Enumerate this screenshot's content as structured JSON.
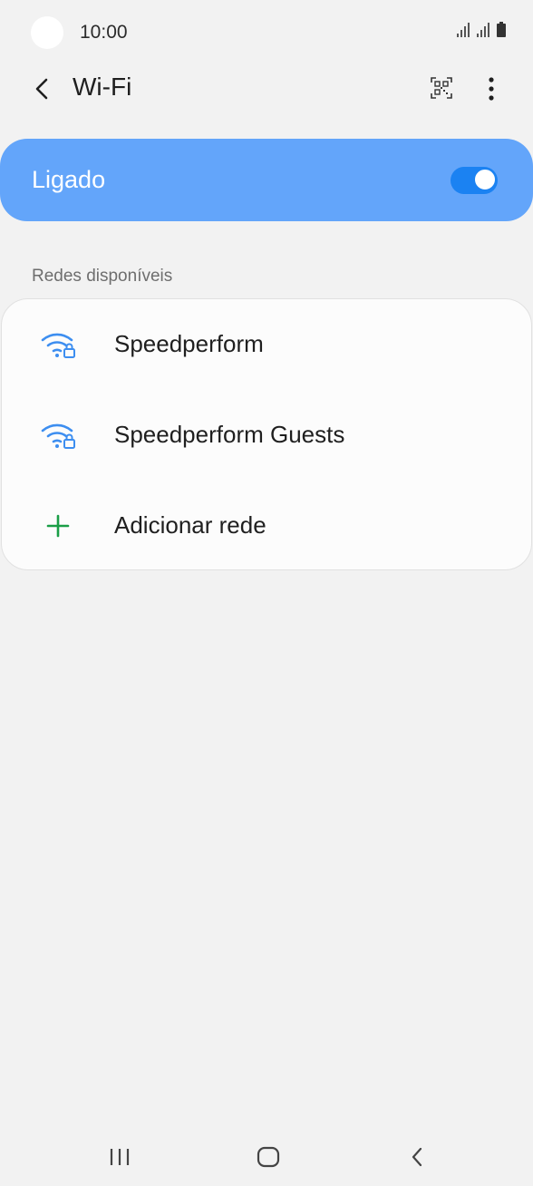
{
  "status_bar": {
    "time": "10:00"
  },
  "app_bar": {
    "title": "Wi-Fi",
    "icons": [
      "back-icon",
      "qr-code-icon",
      "more-vertical-icon"
    ]
  },
  "master_toggle": {
    "label": "Ligado",
    "state": "on",
    "card_color": "#63a5fa",
    "switch_color": "#1b82f2"
  },
  "networks": {
    "header": "Redes disponíveis",
    "items": [
      {
        "label": "Speedperform",
        "icon": "wifi-locked-icon"
      },
      {
        "label": "Speedperform Guests",
        "icon": "wifi-locked-icon"
      }
    ],
    "add_label": "Adicionar rede",
    "add_icon": "plus-icon",
    "wifi_icon_color": "#3d8ef0",
    "add_icon_color": "#1a9e47"
  },
  "nav_bar": {
    "icons": [
      "recents-icon",
      "home-icon",
      "back-icon"
    ]
  }
}
